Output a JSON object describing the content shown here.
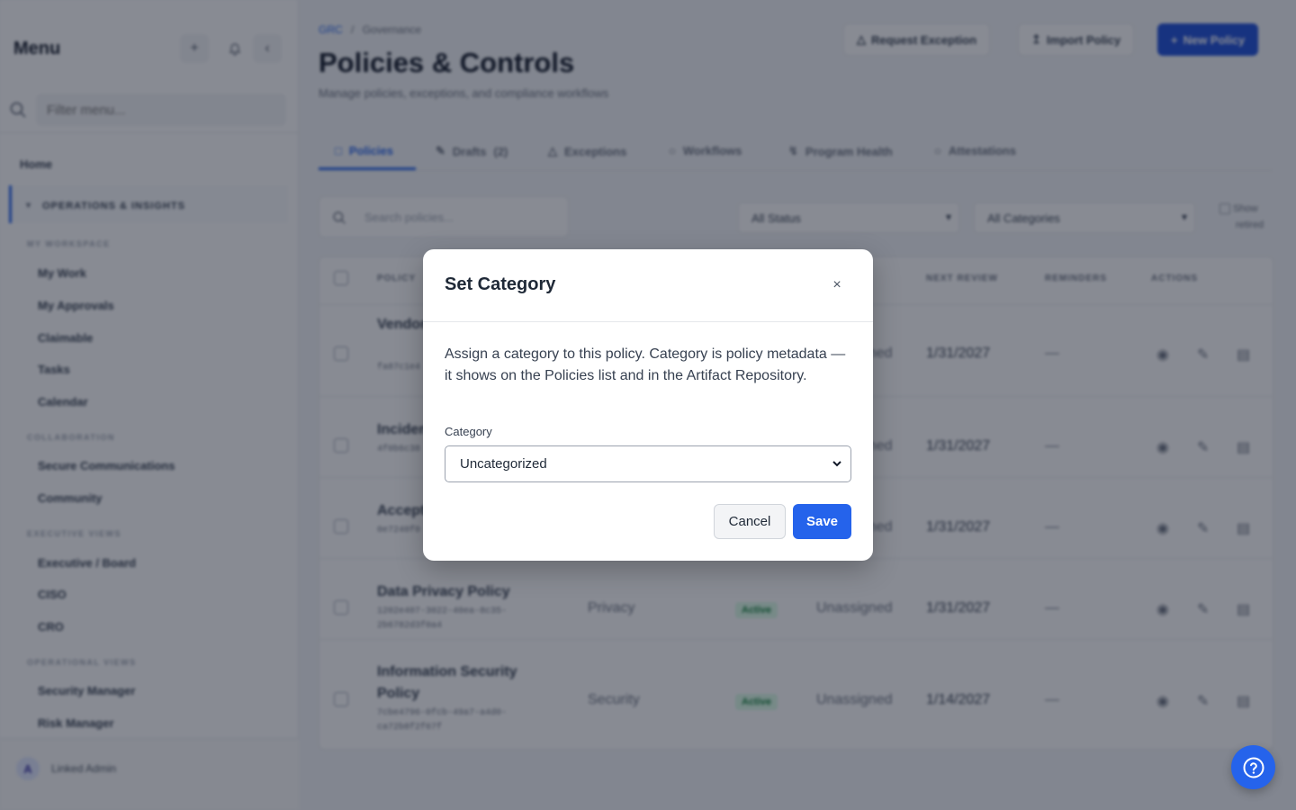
{
  "sidebar": {
    "title": "Menu",
    "filter_placeholder": "Filter menu...",
    "home": "Home",
    "section_title": "OPERATIONS & INSIGHTS",
    "groups": [
      {
        "label": "MY WORKSPACE",
        "items": [
          "My Work",
          "My Approvals",
          "Claimable",
          "Tasks",
          "Calendar"
        ]
      },
      {
        "label": "COLLABORATION",
        "items": [
          "Secure Communications",
          "Community"
        ]
      },
      {
        "label": "EXECUTIVE VIEWS",
        "items": [
          "Executive / Board",
          "CISO",
          "CRO"
        ]
      },
      {
        "label": "OPERATIONAL VIEWS",
        "items": [
          "Security Manager",
          "Risk Manager"
        ]
      }
    ],
    "user": {
      "initial": "A",
      "name": "Linked Admin"
    }
  },
  "header": {
    "breadcrumb_root": "GRC",
    "breadcrumb_sep": "/",
    "breadcrumb_current": "Governance",
    "title": "Policies & Controls",
    "subtitle": "Manage policies, exceptions, and compliance workflows",
    "request_exception": "Request Exception",
    "import_policy": "Import Policy",
    "new_policy": "New Policy"
  },
  "tabs": [
    {
      "label": "Policies",
      "active": true
    },
    {
      "label": "Drafts",
      "count": "(2)"
    },
    {
      "label": "Exceptions"
    },
    {
      "label": "Workflows"
    },
    {
      "label": "Program Health"
    },
    {
      "label": "Attestations"
    }
  ],
  "filters": {
    "search_placeholder": "Search policies...",
    "status": "All Status",
    "category": "All Categories",
    "show_retired_1": "Show",
    "show_retired_2": "retired"
  },
  "table": {
    "headers": {
      "policy": "POLICY",
      "next_review": "NEXT REVIEW",
      "reminders": "REMINDERS",
      "actions": "ACTIONS"
    },
    "rows": [
      {
        "name": "Vendor Policy",
        "id": "fa87c1e4 4600b74",
        "category": "",
        "status": "",
        "owner": "Unassigned",
        "next_review": "1/31/2027",
        "reminders": "—"
      },
      {
        "name": "Incident",
        "id": "4f0b6c38 09f2496",
        "category": "",
        "status": "",
        "owner": "Unassigned",
        "next_review": "1/31/2027",
        "reminders": "—"
      },
      {
        "name": "Accept",
        "id": "0e7240f0 43e6f8",
        "category": "",
        "status": "",
        "owner": "Unassigned",
        "next_review": "1/31/2027",
        "reminders": "—"
      },
      {
        "name": "Data Privacy Policy",
        "id": "1202e407-3022-40ea-8c35-2b6782d3f0a4",
        "category": "Privacy",
        "status": "Active",
        "owner": "Unassigned",
        "next_review": "1/31/2027",
        "reminders": "—"
      },
      {
        "name": "Information Security Policy",
        "id": "7cbe4796-0fcb-49a7-a4d0-ca72b8f2f67f",
        "category": "Security",
        "status": "Active",
        "owner": "Unassigned",
        "next_review": "1/14/2027",
        "reminders": "—"
      }
    ]
  },
  "modal": {
    "title": "Set Category",
    "close": "×",
    "description": "Assign a category to this policy. Category is policy metadata — it shows on the Policies list and in the Artifact Repository.",
    "field_label": "Category",
    "selected_value": "Uncategorized",
    "cancel": "Cancel",
    "save": "Save"
  },
  "colors": {
    "primary": "#2563eb",
    "overlay": "rgba(17,24,39,0.5)",
    "active_badge_bg": "#dcfce7",
    "active_badge_text": "#15803d"
  },
  "icons": [
    "plus-icon",
    "bell-icon",
    "chevron-left-icon",
    "search-icon",
    "document-icon",
    "pencil-icon",
    "warning-icon",
    "clock-icon",
    "pulse-icon",
    "check-circle-icon",
    "eye-icon",
    "edit-icon",
    "archive-icon",
    "help-icon",
    "chevron-down-icon",
    "close-icon"
  ]
}
